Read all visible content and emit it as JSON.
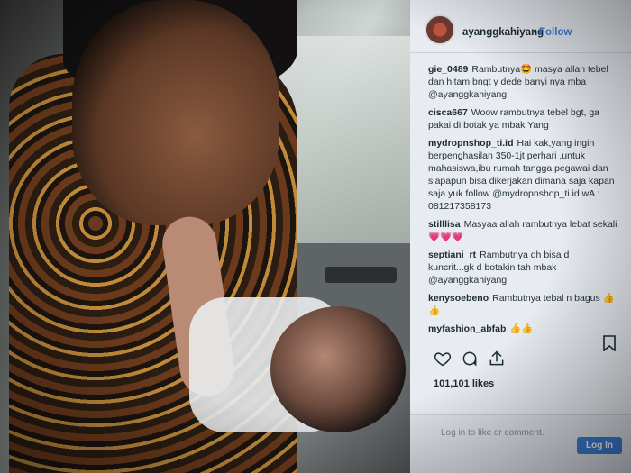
{
  "post": {
    "username": "ayanggkahiyang",
    "separator": "•",
    "follow_label": "Follow",
    "likes": "101,101 likes",
    "time": "",
    "login_prompt": "Log in to like or comment.",
    "login_button": "Log In"
  },
  "comments": [
    {
      "user": "gie_0489",
      "text": "Rambutnya🤩 masya allah tebel dan hitam bngt y dede banyi nya mba @ayanggkahiyang"
    },
    {
      "user": "cisca667",
      "text": "Woow rambutnya tebel bgt, ga pakai di botak ya mbak Yang"
    },
    {
      "user": "mydropnshop_ti.id",
      "text": "Hai kak,yang ingin berpenghasilan 350-1jt perhari ,untuk mahasiswa,ibu rumah tangga,pegawai dan siapapun bisa dikerjakan dimana saja kapan saja.yuk follow @mydropnshop_ti.id wA : 081217358173"
    },
    {
      "user": "stilllisa",
      "text": "Masyaa allah rambutnya lebat sekali 💗💗💗"
    },
    {
      "user": "septiani_rt",
      "text": "Rambutnya dh bisa d kuncrit...gk d botakin tah mbak @ayanggkahiyang"
    },
    {
      "user": "kenysoebeno",
      "text": "Rambutnya tebal n bagus 👍👍"
    },
    {
      "user": "myfashion_abfab",
      "text": "👍👍"
    }
  ],
  "icons": {
    "heart": "heart-icon",
    "comment": "comment-icon",
    "share": "share-icon",
    "bookmark": "bookmark-icon"
  },
  "colors": {
    "accent": "#3c7fd6",
    "panel_bg": "#e8ecf1"
  }
}
